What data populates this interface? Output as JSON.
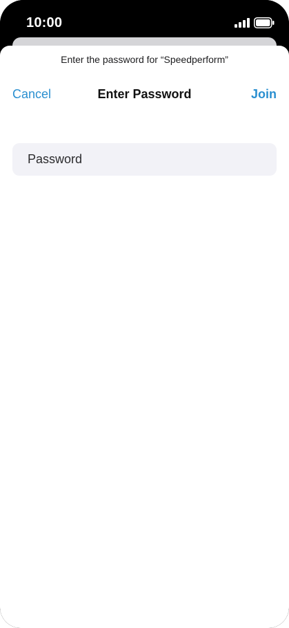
{
  "status_bar": {
    "time": "10:00",
    "icons": [
      "signal-icon",
      "battery-icon"
    ]
  },
  "sheet": {
    "prompt": "Enter the password for “Speedperform”",
    "nav": {
      "cancel_label": "Cancel",
      "title": "Enter Password",
      "join_label": "Join"
    },
    "password": {
      "placeholder": "Password",
      "value": ""
    }
  },
  "colors": {
    "accent": "#2a8fd0",
    "field_background": "#f2f2f7",
    "sheet_background": "#ffffff",
    "frame": "#000000"
  }
}
